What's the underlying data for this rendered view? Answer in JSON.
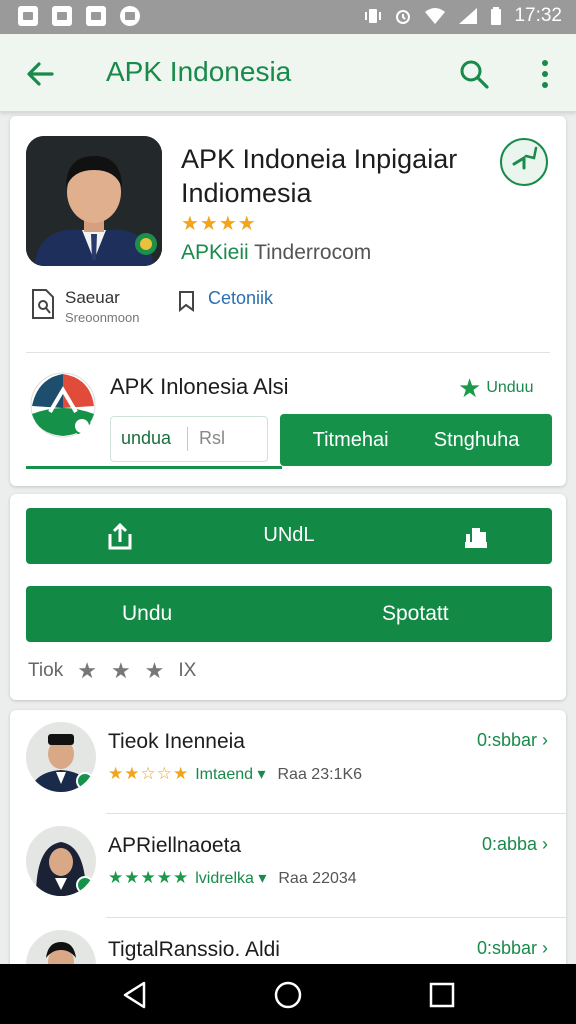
{
  "status_bar": {
    "time": "17:32"
  },
  "app_bar": {
    "title": "APK Indonesia"
  },
  "app_card": {
    "name": "APK Indoneia Inpigaiar Indiomesia",
    "stars": "★★★★",
    "developer_green": "APKieii",
    "developer_rest": " Tinderrocom",
    "meta1_title": "Saeuar",
    "meta1_sub": "Sreoonmoon",
    "meta2_label": "Cetoniik",
    "row_title": "APK Inlonesia Alsi",
    "row_tag": "Unduu",
    "btn_outline_a": "undua",
    "btn_outline_b": "Rsl",
    "btn_green_a": "Titmehai",
    "btn_green_b": "Stnghuha"
  },
  "actions_card": {
    "button1_label": "UNdL",
    "button2_left": "Undu",
    "button2_right": "Spotatt",
    "rating_label": "Tiok",
    "rating_value": "IX"
  },
  "list": [
    {
      "name": "Tieok Inenneia",
      "stars": "★★☆☆★",
      "stars_color": "#f2a51b",
      "dev": "Imtaend ▾",
      "rest": "Raa 23:1K6",
      "action": "0:sbbar ›"
    },
    {
      "name": "APRiellnaoeta",
      "stars": "★★★★★",
      "stars_color": "#1a9a4a",
      "dev": "lvidrelka ▾",
      "rest": "Raa 22034",
      "action": "0:abba ›"
    },
    {
      "name": "TigtalRanssio. Aldi",
      "stars": "",
      "stars_color": "#f2a51b",
      "dev": "",
      "rest": "",
      "action": "0:sbbar ›"
    }
  ]
}
